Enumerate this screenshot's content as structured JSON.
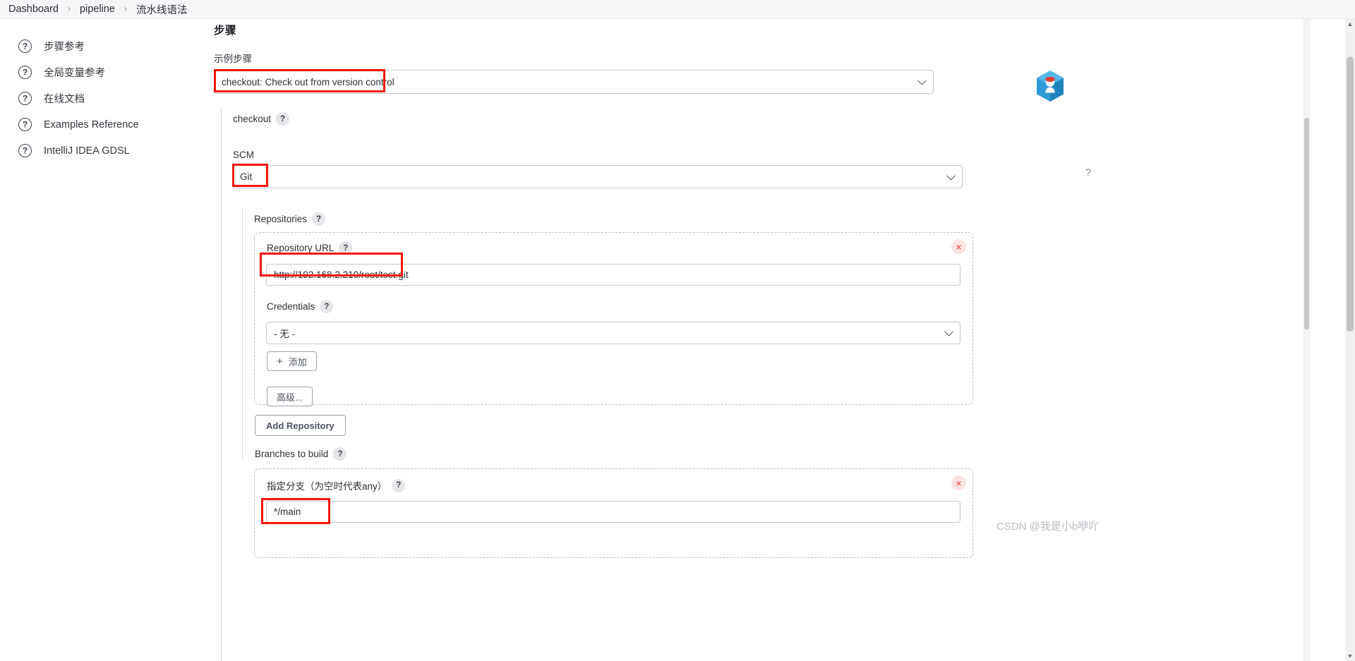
{
  "breadcrumb": {
    "items": [
      "Dashboard",
      "pipeline",
      "流水线语法"
    ],
    "separator": "›"
  },
  "sidebar": {
    "items": [
      {
        "label": "步骤参考",
        "icon": "question-circle-icon"
      },
      {
        "label": "全局变量参考",
        "icon": "question-circle-icon"
      },
      {
        "label": "在线文档",
        "icon": "question-circle-icon"
      },
      {
        "label": "Examples Reference",
        "icon": "question-circle-icon"
      },
      {
        "label": "IntelliJ IDEA GDSL",
        "icon": "question-circle-icon"
      }
    ]
  },
  "main": {
    "section_title": "步骤",
    "sample_step_label": "示例步骤",
    "step_select": {
      "value": "checkout: Check out from version control",
      "icon": "chevron-down-icon"
    },
    "checkout": {
      "title": "checkout",
      "help": "?",
      "scm_label": "SCM",
      "scm_select": {
        "value": "Git",
        "icon": "chevron-down-icon"
      },
      "repositories": {
        "label": "Repositories",
        "help": "?",
        "repo": {
          "url_label": "Repository URL",
          "url_help": "?",
          "url_value": "http://192.168.2.210/root/test.git",
          "credentials_label": "Credentials",
          "credentials_help": "?",
          "credentials_value": "- 无 -",
          "credentials_icon": "chevron-down-icon",
          "add_button": "添加",
          "add_icon": "plus-icon",
          "advanced_button": "高级...",
          "delete_icon": "×"
        },
        "add_repository_button": "Add Repository"
      },
      "branches": {
        "label": "Branches to build",
        "help": "?",
        "branch": {
          "spec_label": "指定分支（为空时代表any）",
          "spec_help": "?",
          "spec_value": "*/main",
          "delete_icon": "×"
        }
      }
    },
    "side_help_icon": "?"
  },
  "logo": {
    "name": "jenkins-logo",
    "color": "#2d9dd8"
  },
  "watermark": "CSDN @我是小b咿吖",
  "colors": {
    "annotation": "#f3170d",
    "delete": "#e2362c",
    "border": "#c3c9ce",
    "breadcrumb_bg": "#f6f7f9"
  }
}
